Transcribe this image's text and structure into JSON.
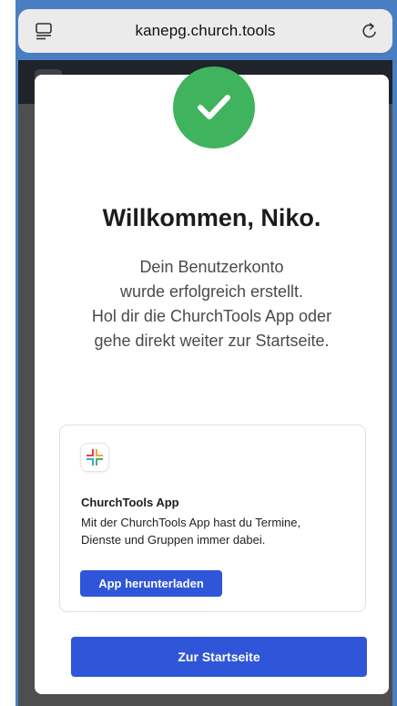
{
  "browser": {
    "url": "kanepg.church.tools",
    "tabs_icon": "tabs-icon",
    "reload_icon": "reload-icon"
  },
  "modal": {
    "status_icon": "checkmark-icon",
    "title": "Willkommen, Niko.",
    "message_lines": [
      "Dein Benutzerkonto",
      "wurde erfolgreich erstellt.",
      "Hol dir die ChurchTools App oder",
      "gehe direkt weiter zur Startseite."
    ],
    "app_card": {
      "logo_icon": "churchtools-logo-icon",
      "title": "ChurchTools App",
      "description_lines": [
        "Mit der ChurchTools App hast du Termine,",
        "Dienste und Gruppen immer dabei."
      ],
      "download_label": "App herunterladen"
    },
    "primary_label": "Zur Startseite"
  },
  "colors": {
    "accent": "#2f55d8",
    "success": "#3fb35e",
    "frame": "#4a7ec2",
    "header_dark": "#1e2429"
  }
}
